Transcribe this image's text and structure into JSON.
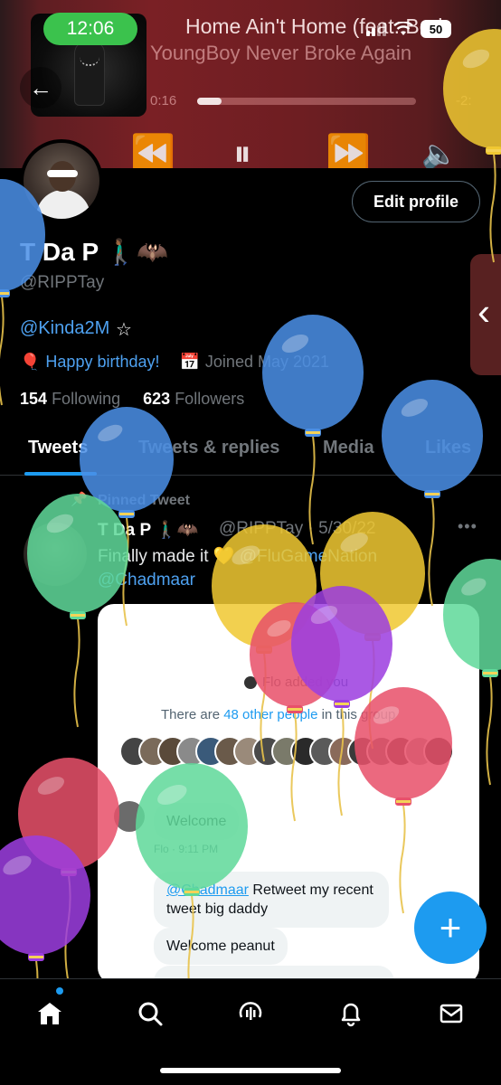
{
  "status_bar": {
    "time": "12:06",
    "battery": "50"
  },
  "now_playing": {
    "title": "Home Ain't Home (feat. Bod",
    "artist": "YoungBoy Never Broke Again",
    "elapsed": "0:16",
    "remaining": "-2:",
    "progress": 0.11
  },
  "profile": {
    "display_name": "T Da P 🚶🏾‍♂️🦇",
    "handle": "@RIPPTay",
    "bio_link": "@Kinda2M",
    "bio_suffix": "☆",
    "birthday": "Happy birthday!",
    "joined": "Joined May 2021",
    "following_count": "154",
    "following_label": "Following",
    "followers_count": "623",
    "followers_label": "Followers",
    "edit_label": "Edit profile"
  },
  "tabs": [
    "Tweets",
    "Tweets & replies",
    "Media",
    "Likes"
  ],
  "tweet": {
    "pinned_label": "Pinned Tweet",
    "name": "T Da P 🚶🏾‍♂️🦇",
    "handle_date": "@RIPPTay · 5/30/22",
    "text": "Finally made it 💛 ",
    "mention1": "@FluGameNation",
    "mention2": "@Chadmaar",
    "media": {
      "added_text": "Flo added you",
      "count_prefix": "There are ",
      "count_link": "48 other people",
      "count_suffix": " in this group",
      "msg_welcome": "Welcome",
      "msg_meta": "Flo · 9:11 PM",
      "msg_retweet_mention": "@Chadmaar",
      "msg_retweet_text": " Retweet my recent tweet big daddy",
      "msg_peanut": "Welcome peanut"
    }
  },
  "fab": "+",
  "colors": {
    "accent": "#1d9bf0",
    "background": "#000000"
  },
  "icons": {
    "nav": [
      "home-icon",
      "search-icon",
      "spaces-icon",
      "notifications-icon",
      "messages-icon"
    ]
  }
}
